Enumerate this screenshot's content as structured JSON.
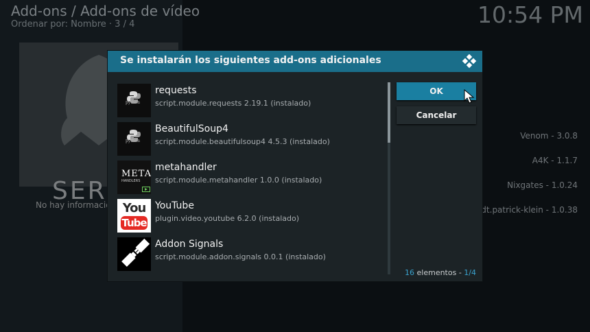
{
  "background": {
    "title": "Add-ons / Add-ons de vídeo",
    "subtitle": "Ordenar por: Nombre  ·  3 / 4",
    "clock": "10:54 PM",
    "thumbnail_text": "SERE",
    "info_text": "No hay información",
    "list_items": [
      "Venom - 3.0.8",
      "A4K - 1.1.7",
      "Nixgates - 1.0.24",
      "elyeldt.patrick-klein - 1.0.38"
    ]
  },
  "dialog": {
    "title": "Se instalarán los siguientes add-ons adicionales",
    "ok_label": "OK",
    "cancel_label": "Cancelar",
    "count_number": "16",
    "count_word": " elementos - ",
    "count_page": "1/4",
    "items": [
      {
        "name": "requests",
        "desc": "script.module.requests 2.19.1 (instalado)",
        "icon": "python-icon"
      },
      {
        "name": "BeautifulSoup4",
        "desc": "script.module.beautifulsoup4 4.5.3 (instalado)",
        "icon": "python-icon"
      },
      {
        "name": "metahandler",
        "desc": "script.module.metahandler 1.0.0 (instalado)",
        "icon": "metahandler-icon"
      },
      {
        "name": "YouTube",
        "desc": "plugin.video.youtube 6.2.0 (instalado)",
        "icon": "youtube-icon"
      },
      {
        "name": "Addon Signals",
        "desc": "script.module.addon.signals 0.0.1 (instalado)",
        "icon": "plug-icon"
      }
    ],
    "thumb_text": {
      "python_word": "python",
      "meta_word": "META",
      "meta_sub": "HANDLERS",
      "youtube_top": "You",
      "youtube_bottom": "Tube"
    }
  },
  "colors": {
    "header": "#1a6e8a",
    "ok_button": "#1a7fa1",
    "accent_text": "#3aa3cf"
  }
}
